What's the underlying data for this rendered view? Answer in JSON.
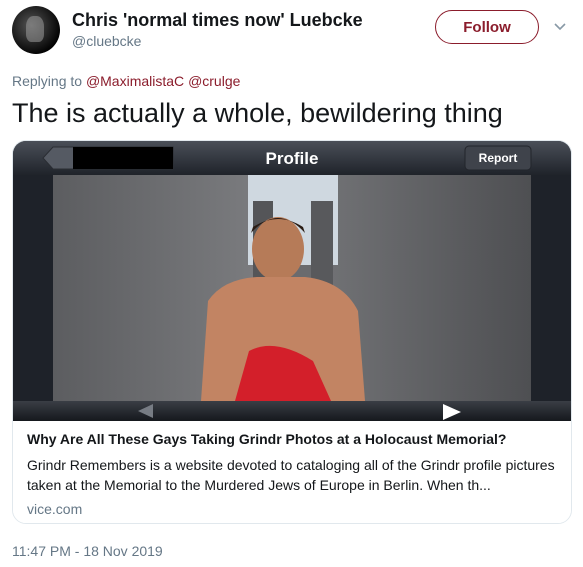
{
  "author": {
    "name": "Chris 'normal times now' Luebcke",
    "handle": "@cluebcke"
  },
  "follow_label": "Follow",
  "reply": {
    "prefix": "Replying to",
    "mentions": [
      "@MaximalistaC",
      "@crulge"
    ]
  },
  "tweet_text": "The is actually a whole, bewildering thing",
  "card": {
    "image": {
      "screen_title": "Profile",
      "report_label": "Report"
    },
    "title": "Why Are All These Gays Taking Grindr Photos at a Holocaust Memorial?",
    "description": "Grindr Remembers is a website devoted to cataloging all of the Grindr profile pictures taken at the Memorial to the Murdered Jews of Europe in Berlin. When th...",
    "domain": "vice.com"
  },
  "timestamp": "11:47 PM - 18 Nov 2019",
  "colors": {
    "accent": "#8b1d2c",
    "secondary_text": "#657786"
  },
  "icons": {
    "menu": "chevron-down-icon",
    "next": "arrow-right-icon",
    "prev": "arrow-left-icon"
  }
}
